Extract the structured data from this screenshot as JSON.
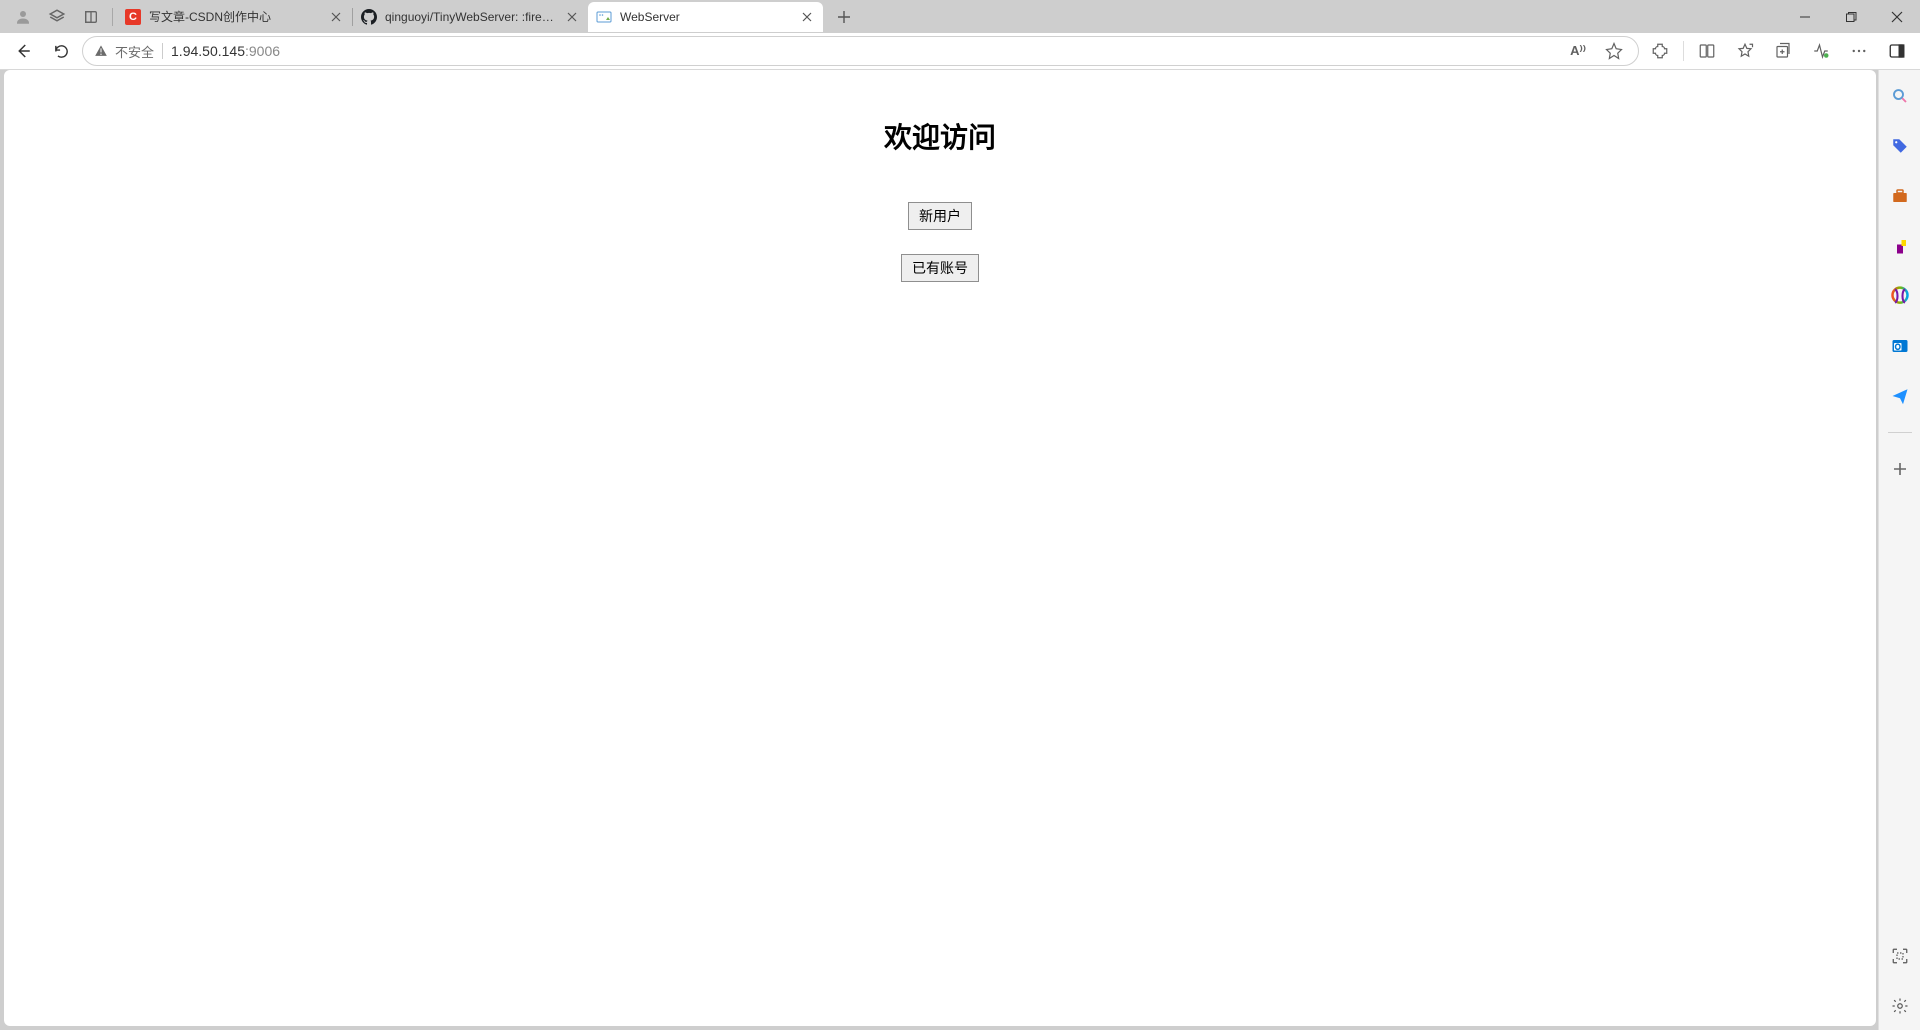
{
  "tabs": [
    {
      "title": "写文章-CSDN创作中心",
      "favicon_label": "C"
    },
    {
      "title": "qinguoyi/TinyWebServer: :fire: Lin"
    },
    {
      "title": "WebServer"
    }
  ],
  "address": {
    "security_text": "不安全",
    "url_host": "1.94.50.145",
    "url_port": ":9006"
  },
  "page": {
    "heading": "欢迎访问",
    "button_new_user": "新用户",
    "button_existing": "已有账号"
  },
  "toolbar_icons": {
    "read_aloud": "A⁾⁾"
  }
}
